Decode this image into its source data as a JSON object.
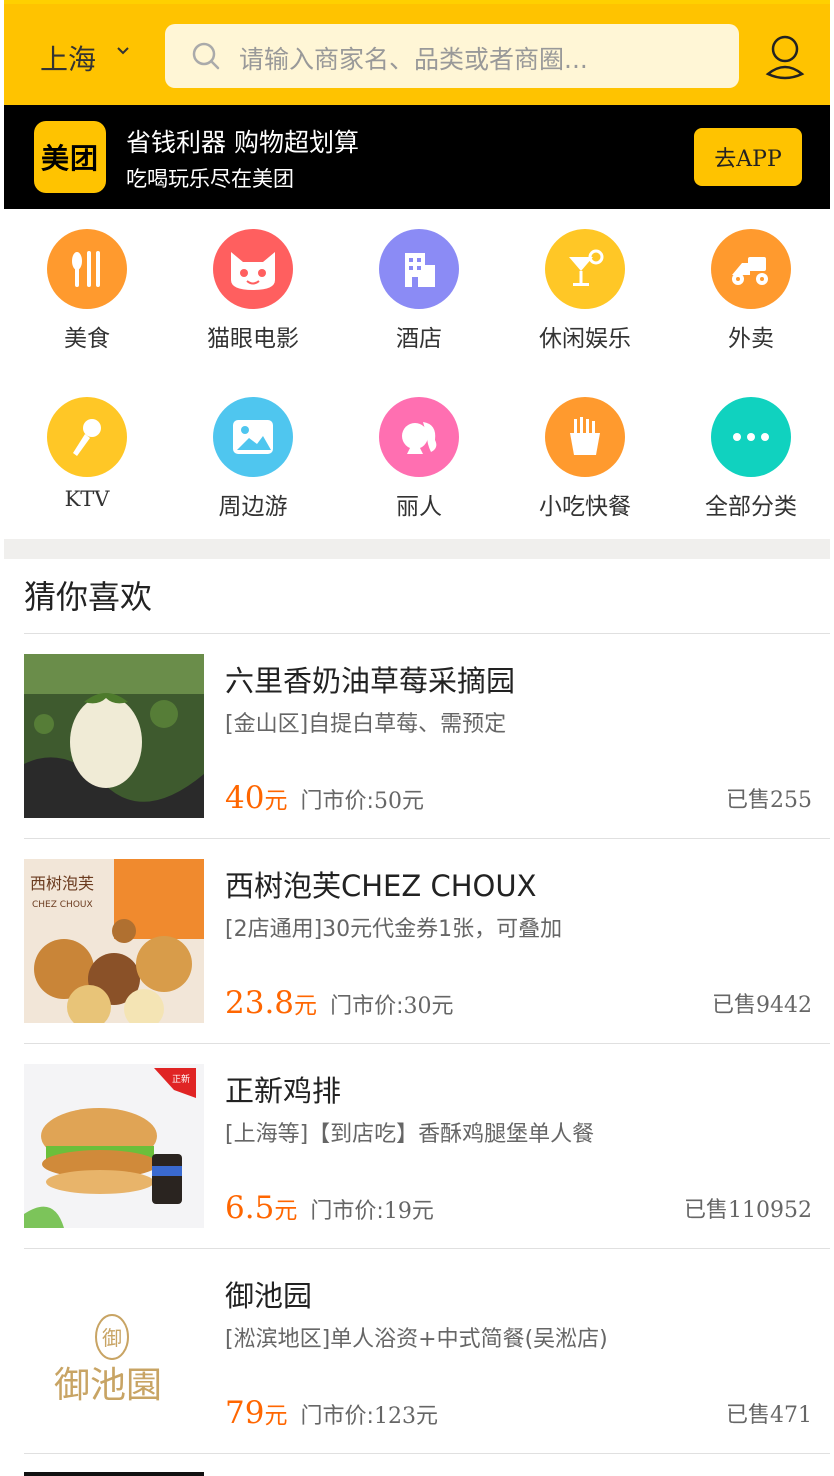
{
  "header": {
    "city": "上海",
    "search_placeholder": "请输入商家名、品类或者商圈..."
  },
  "banner": {
    "logo_text": "美团",
    "title": "省钱利器 购物超划算",
    "subtitle": "吃喝玩乐尽在美团",
    "app_button": "去APP"
  },
  "categories": [
    {
      "label": "美食",
      "icon": "fork-knife-icon",
      "color": "#ff9a2e"
    },
    {
      "label": "猫眼电影",
      "icon": "cat-icon",
      "color": "#ff5f5f"
    },
    {
      "label": "酒店",
      "icon": "hotel-icon",
      "color": "#8b8bf5"
    },
    {
      "label": "休闲娱乐",
      "icon": "cocktail-icon",
      "color": "#ffc726"
    },
    {
      "label": "外卖",
      "icon": "scooter-icon",
      "color": "#ff9a2e"
    },
    {
      "label": "KTV",
      "icon": "microphone-icon",
      "color": "#ffc726"
    },
    {
      "label": "周边游",
      "icon": "landscape-icon",
      "color": "#4fc6ef"
    },
    {
      "label": "丽人",
      "icon": "woman-icon",
      "color": "#ff6fb1"
    },
    {
      "label": "小吃快餐",
      "icon": "fries-icon",
      "color": "#ff9a2e"
    },
    {
      "label": "全部分类",
      "icon": "more-dots-icon",
      "color": "#10d2bf"
    }
  ],
  "guess": {
    "title": "猜你喜欢",
    "items": [
      {
        "name": "六里香奶油草莓采摘园",
        "desc": "[金山区]自提白草莓、需预定",
        "price": "40",
        "unit": "元",
        "market_label": "门市价:",
        "market_price": "50",
        "market_unit": "元",
        "sold_label": "已售",
        "sold": "255"
      },
      {
        "name": "西树泡芙CHEZ CHOUX",
        "desc": "[2店通用]30元代金券1张，可叠加",
        "price": "23.8",
        "unit": "元",
        "market_label": "门市价:",
        "market_price": "30",
        "market_unit": "元",
        "sold_label": "已售",
        "sold": "9442"
      },
      {
        "name": "正新鸡排",
        "desc": "[上海等]【到店吃】香酥鸡腿堡单人餐",
        "price": "6.5",
        "unit": "元",
        "market_label": "门市价:",
        "market_price": "19",
        "market_unit": "元",
        "sold_label": "已售",
        "sold": "110952"
      },
      {
        "name": "御池园",
        "desc": "[淞滨地区]单人浴资+中式简餐(吴淞店)",
        "price": "79",
        "unit": "元",
        "market_label": "门市价:",
        "market_price": "123",
        "market_unit": "元",
        "sold_label": "已售",
        "sold": "471"
      }
    ],
    "thumb_texts": {
      "choux_brand": "西树泡芙",
      "choux_brand_en": "CHEZ CHOUX",
      "chicken_tag": "正新",
      "yuchi_seal": "御",
      "yuchi_name": "御池園"
    }
  },
  "colors": {
    "accent": "#ffc300",
    "price": "#ff6600"
  }
}
